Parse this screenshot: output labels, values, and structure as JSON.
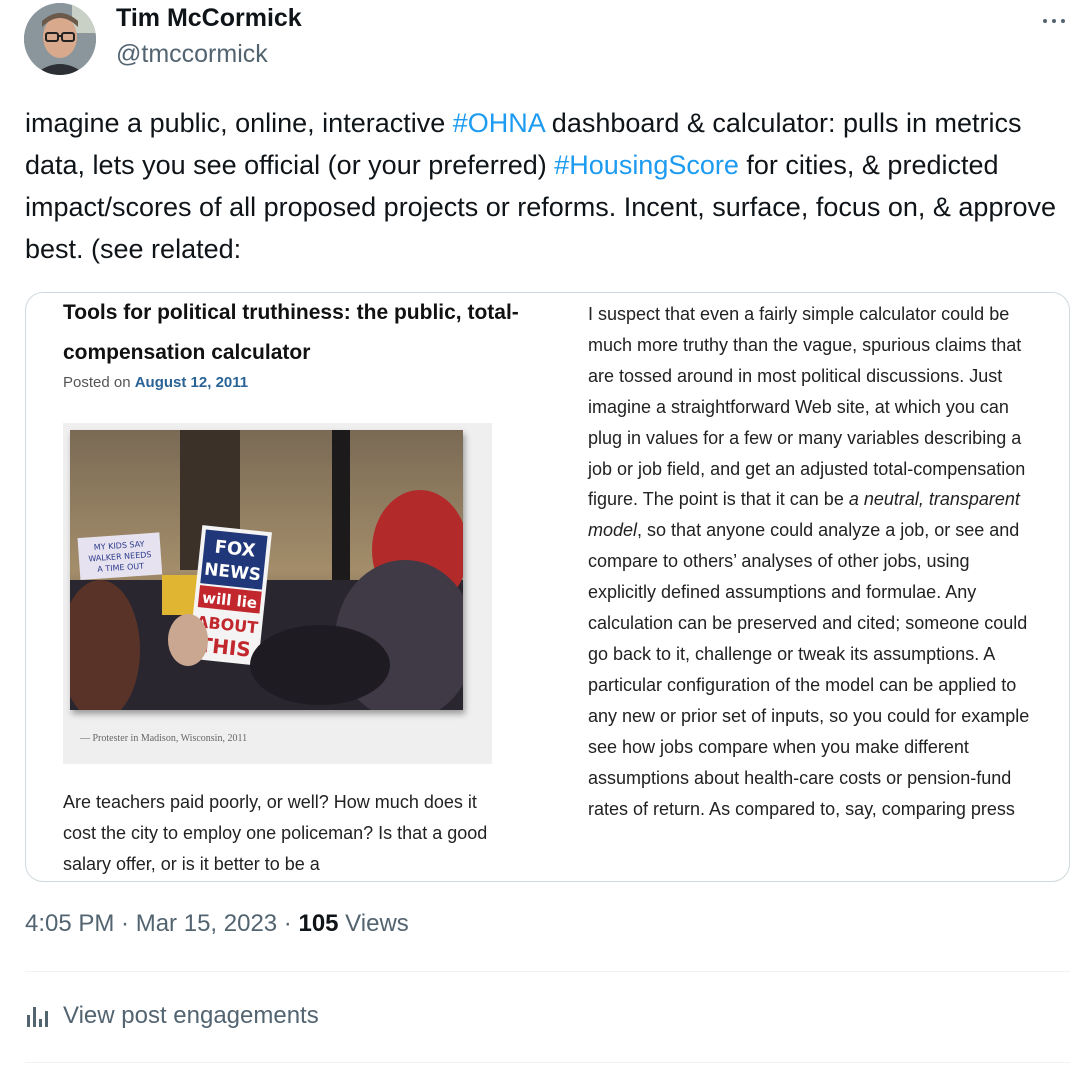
{
  "author": {
    "name": "Tim McCormick",
    "handle": "@tmccormick"
  },
  "tweet": {
    "t1": "imagine a public, online, interactive ",
    "h1": "#OHNA",
    "t2": " dashboard & calculator: pulls in metrics data, lets you see official (or your preferred) ",
    "h2": "#HousingScore",
    "t3": " for cities, & predicted impact/scores of all proposed projects or reforms. Incent, surface, focus on, & approve best. (see related:"
  },
  "card": {
    "title": "Tools for political truthiness: the public, total-compensation calculator",
    "posted_prefix": "Posted on ",
    "posted_date": "August 12, 2011",
    "photo_caption": "—    Protester in Madison, Wisconsin, 2011",
    "sign_text": [
      "FOX",
      "NEWS",
      "will lie",
      "ABOUT",
      "THIS"
    ],
    "small_sign_text": "MY KIDS SAY WALKER NEEDS A TIME OUT",
    "left_body": "Are teachers paid poorly, or well?   How much does it cost the city to employ one policeman?  Is that a good salary offer, or is it better to be a",
    "right_body_1": "I suspect that even a fairly simple calculator could be much more truthy than the vague, spurious claims that are tossed around in most political discussions.  Just imagine a straightforward Web site, at which you can plug in values for a few or many variables describing a job or job field, and get an adjusted total-compensation figure.  The point is that it can be ",
    "right_body_em": "a neutral, transparent model",
    "right_body_2": ", so that anyone could analyze a job, or see and compare to others’ analyses of other jobs, using explicitly defined assumptions and formulae.  Any calculation can be preserved and cited;  someone could go back to it, challenge or tweak its assumptions.  A particular configuration of the model can be applied to any new or prior set of inputs, so you could for example see how jobs compare when you make different assumptions about health-care costs or pension-fund rates of return.  As compared to, say, comparing press"
  },
  "meta": {
    "time": "4:05 PM",
    "sep1": " · ",
    "date": "Mar 15, 2023",
    "sep2": " · ",
    "views_count": "105",
    "views_label": " Views"
  },
  "engagements_label": "View post engagements",
  "icons": {
    "more": "more-horizontal-icon",
    "engagements": "analytics-bars-icon"
  },
  "colors": {
    "hashtag": "#1d9bf0",
    "secondary_text": "#536471",
    "link_date": "#2a6496"
  }
}
